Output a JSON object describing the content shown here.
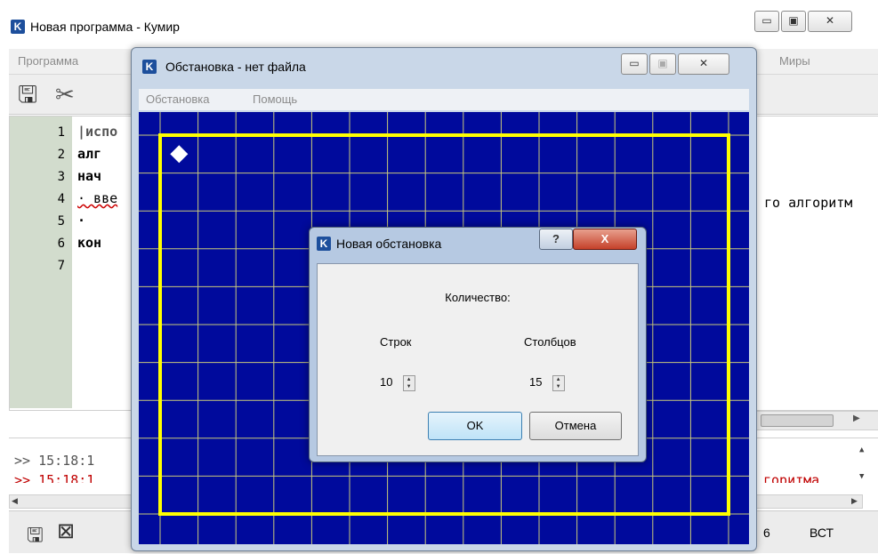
{
  "main_window": {
    "title": "Новая программа - Кумир",
    "app_icon_letter": "K",
    "menu": {
      "program": "Программа",
      "worlds": "Миры"
    },
    "line_numbers": [
      "1",
      "2",
      "3",
      "4",
      "5",
      "6",
      "7"
    ],
    "code_lines": [
      "|испо",
      "алг",
      "нач",
      "· вве",
      "·",
      "кон",
      ""
    ],
    "code_right_fragment": "го алгоритм",
    "console_lines": [
      ">> 15:18:1",
      ">> 15:18:1"
    ],
    "console_right_fragment": "горитма",
    "status": {
      "position": "6",
      "mode": "ВСТ"
    }
  },
  "env_window": {
    "title": "Обстановка - нет файла",
    "app_icon_letter": "K",
    "menu": {
      "environment": "Обстановка",
      "help": "Помощь"
    },
    "grid": {
      "rows": 10,
      "cols": 15,
      "background": "#000a9c",
      "frame_color": "#ffff00"
    }
  },
  "dialog": {
    "title": "Новая обстановка",
    "app_icon_letter": "K",
    "help_button": "?",
    "close_button": "X",
    "heading": "Количество:",
    "rows_label": "Строк",
    "cols_label": "Столбцов",
    "rows_value": "10",
    "cols_value": "15",
    "ok_label": "OK",
    "cancel_label": "Отмена"
  }
}
